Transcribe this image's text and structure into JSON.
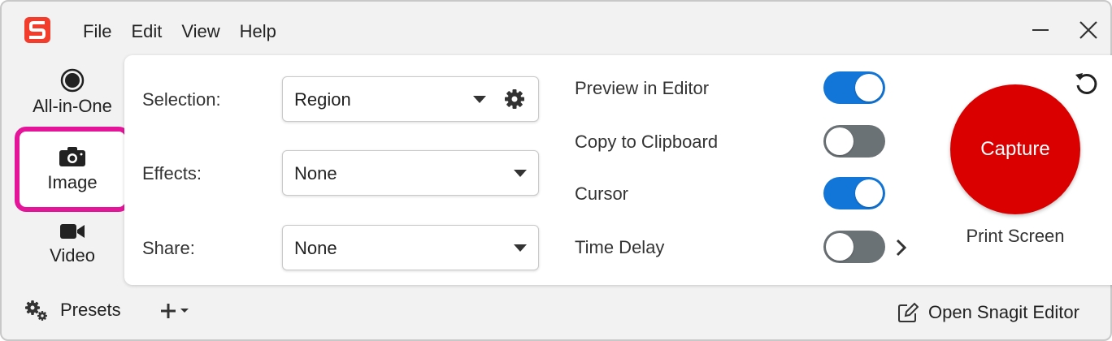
{
  "colors": {
    "accent": "#1276d8",
    "capture": "#db0000",
    "highlight": "#e5159a",
    "logo": "#f23c2c"
  },
  "app": {
    "logo_icon": "snagit-logo-icon"
  },
  "menu": [
    "File",
    "Edit",
    "View",
    "Help"
  ],
  "modes": {
    "all_in_one": "All-in-One",
    "image": "Image",
    "video": "Video",
    "selected": "Image"
  },
  "settings": {
    "selection": {
      "label": "Selection:",
      "value": "Region"
    },
    "effects": {
      "label": "Effects:",
      "value": "None"
    },
    "share": {
      "label": "Share:",
      "value": "None"
    }
  },
  "options": [
    {
      "label": "Preview in Editor",
      "on": true
    },
    {
      "label": "Copy to Clipboard",
      "on": false
    },
    {
      "label": "Cursor",
      "on": true
    },
    {
      "label": "Time Delay",
      "on": false
    }
  ],
  "capture": {
    "label": "Capture",
    "hotkey": "Print Screen"
  },
  "footer": {
    "presets": "Presets",
    "open_editor": "Open Snagit Editor"
  }
}
